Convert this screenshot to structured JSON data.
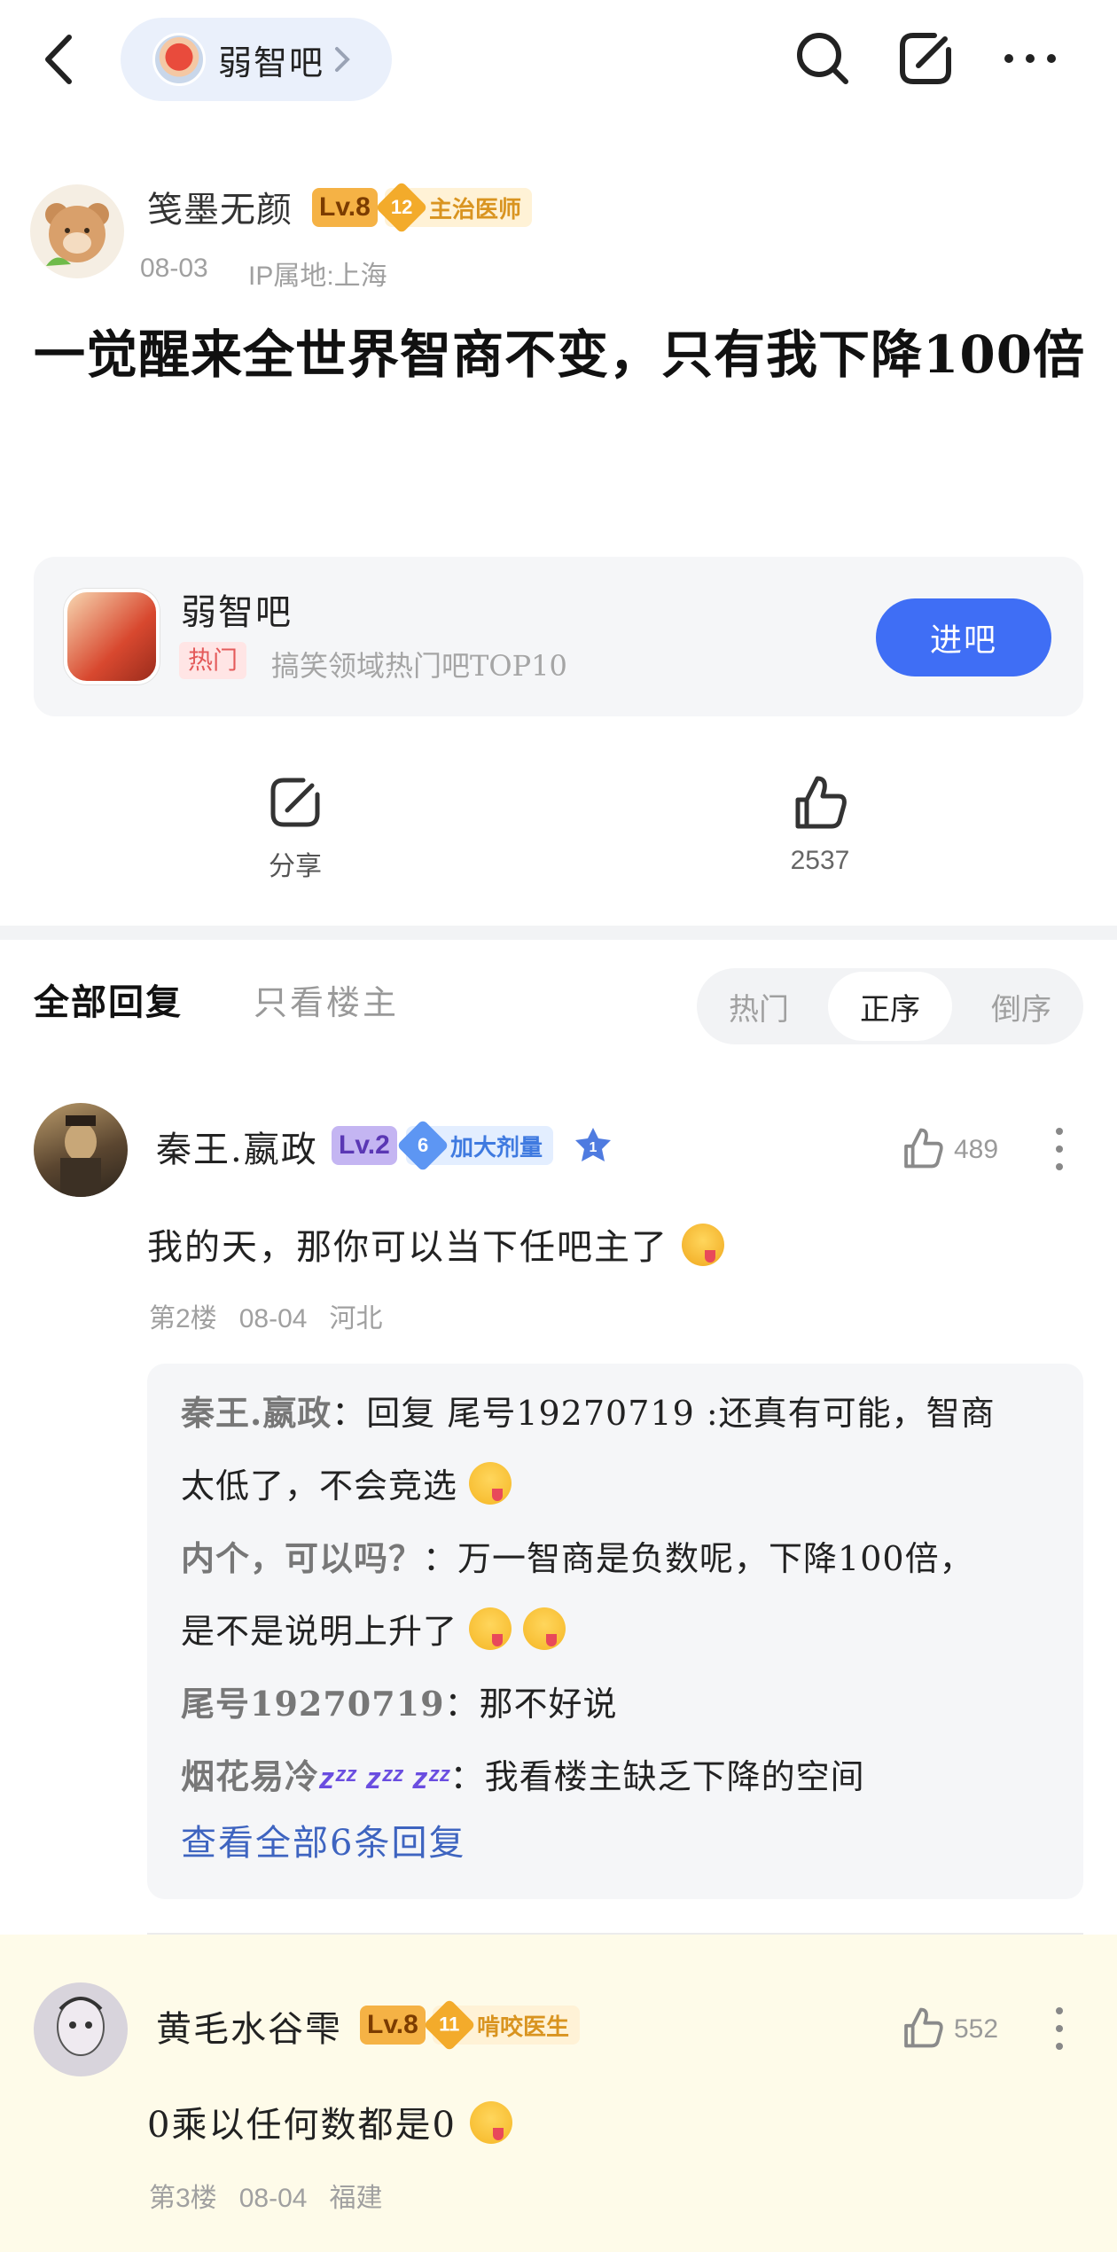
{
  "topbar": {
    "forum_name": "弱智吧"
  },
  "author": {
    "name": "笺墨无颜",
    "level": "Lv.8",
    "title_rank": "12",
    "title": "主治医师",
    "date": "08-03",
    "ip": "IP属地:上海"
  },
  "post": {
    "title": "一觉醒来全世界智商不变，只有我下降100倍"
  },
  "forum_card": {
    "name": "弱智吧",
    "hot_tag": "热门",
    "desc": "搞笑领域热门吧TOP10",
    "enter_label": "进吧"
  },
  "actions": {
    "share_label": "分享",
    "like_count": "2537"
  },
  "tabs": {
    "all": "全部回复",
    "owner_only": "只看楼主"
  },
  "sort": {
    "hot": "热门",
    "asc": "正序",
    "desc": "倒序",
    "selected": "正序"
  },
  "replies": [
    {
      "name": "秦王.嬴政",
      "level": "Lv.2",
      "title_rank": "6",
      "title": "加大剂量",
      "rank_badge": "1",
      "likes": "489",
      "text": "我的天，那你可以当下任吧主了",
      "floor": "第2楼",
      "date": "08-04",
      "location": "河北",
      "sub_replies": [
        {
          "user": "秦王.嬴政",
          "sep": "：",
          "text_a": "回复 尾号19270719 :还真有可能，智商",
          "text_b": "太低了，不会竞选"
        },
        {
          "user": "内个，可以吗？",
          "sep": "：",
          "text_a": "万一智商是负数呢，下降100倍，",
          "text_b": "是不是说明上升了"
        },
        {
          "user": "尾号19270719",
          "sep": "：",
          "text": "那不好说"
        },
        {
          "user": "烟花易冷",
          "user_deco": "zᶻᶻ zᶻᶻ zᶻᶻ",
          "sep": "：",
          "text": "我看楼主缺乏下降的空间"
        }
      ],
      "more_label": "查看全部6条回复"
    },
    {
      "name": "黄毛水谷雫",
      "level": "Lv.8",
      "title_rank": "11",
      "title": "啃咬医生",
      "likes": "552",
      "text": "0乘以任何数都是0",
      "floor": "第3楼",
      "date": "08-04",
      "location": "福建"
    }
  ],
  "colors": {
    "accent": "#3f6ef5",
    "link": "#3e64c0",
    "highlight_bg": "#fefbe9"
  },
  "icons": [
    "back-icon",
    "chevron-right-icon",
    "search-icon",
    "edit-icon",
    "more-icon",
    "share-icon",
    "thumbs-up-icon",
    "kebab-icon"
  ]
}
